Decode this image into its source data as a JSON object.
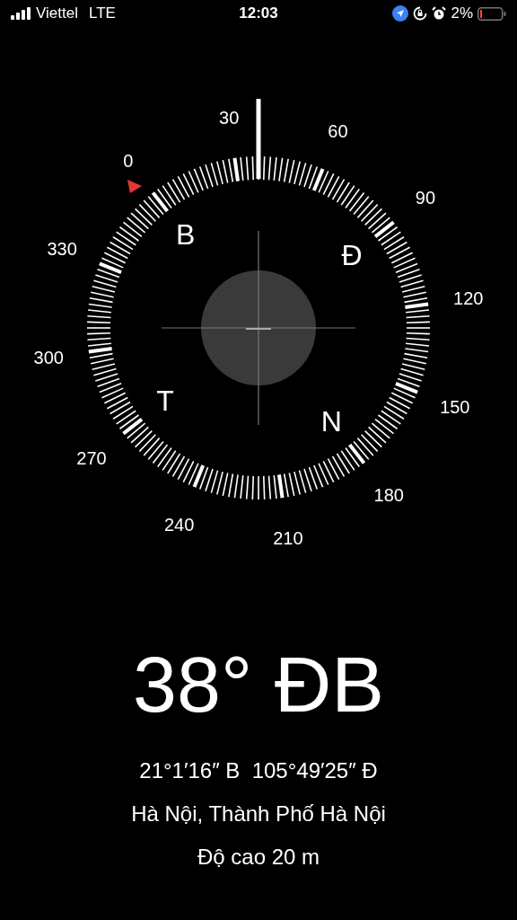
{
  "status_bar": {
    "carrier": "Viettel",
    "network": "LTE",
    "time": "12:03",
    "battery": "2%"
  },
  "compass": {
    "degree_labels": [
      "0",
      "30",
      "60",
      "90",
      "120",
      "150",
      "180",
      "210",
      "240",
      "270",
      "300",
      "330"
    ],
    "cardinal_labels": [
      "B",
      "Đ",
      "N",
      "T"
    ]
  },
  "heading": "38° ĐB",
  "coordinates": "21°1′16″ B  105°49′25″ Đ",
  "place": "Hà Nội, Thành Phố Hà Nội",
  "altitude": "Độ cao 20 m"
}
